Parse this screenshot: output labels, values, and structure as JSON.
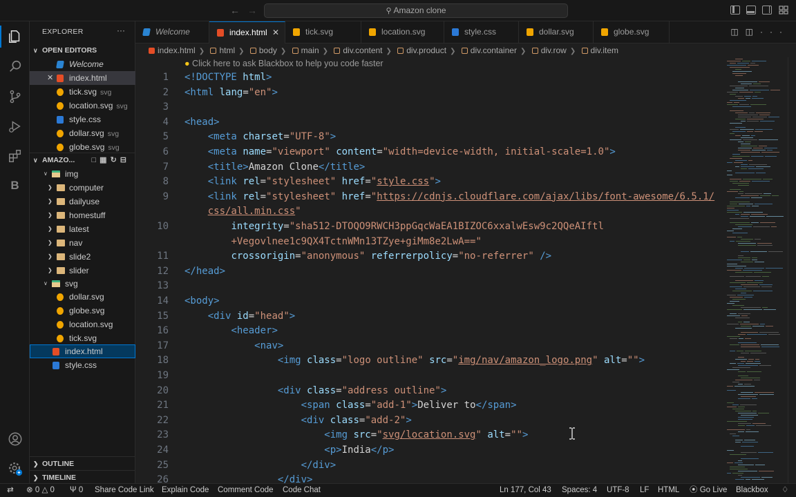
{
  "titlebar": {
    "search_text": "Amazon clone",
    "back_icon": "arrow-left",
    "forward_icon": "arrow-right"
  },
  "activitybar": {
    "items": [
      "explorer",
      "search",
      "source-control",
      "run-and-debug",
      "extensions",
      "blackbox"
    ],
    "blackbox_letter": "B"
  },
  "sidebar": {
    "title": "EXPLORER",
    "more": "···",
    "open_editors": {
      "title": "OPEN EDITORS",
      "items": [
        {
          "name": "Welcome",
          "desc": ""
        },
        {
          "name": "index.html",
          "desc": ""
        },
        {
          "name": "tick.svg",
          "desc": "svg"
        },
        {
          "name": "location.svg",
          "desc": "svg"
        },
        {
          "name": "style.css",
          "desc": ""
        },
        {
          "name": "dollar.svg",
          "desc": "svg"
        },
        {
          "name": "globe.svg",
          "desc": "svg"
        }
      ]
    },
    "workspace": {
      "title": "AMAZO...",
      "tree": [
        {
          "name": "img"
        },
        {
          "name": "computer"
        },
        {
          "name": "dailyuse"
        },
        {
          "name": "homestuff"
        },
        {
          "name": "latest"
        },
        {
          "name": "nav"
        },
        {
          "name": "slide2"
        },
        {
          "name": "slider"
        },
        {
          "name": "svg"
        },
        {
          "name": "dollar.svg"
        },
        {
          "name": "globe.svg"
        },
        {
          "name": "location.svg"
        },
        {
          "name": "tick.svg"
        },
        {
          "name": "index.html"
        },
        {
          "name": "style.css"
        }
      ]
    },
    "outline": "OUTLINE",
    "timeline": "TIMELINE"
  },
  "tabs": [
    {
      "label": "Welcome"
    },
    {
      "label": "index.html"
    },
    {
      "label": "tick.svg"
    },
    {
      "label": "location.svg"
    },
    {
      "label": "style.css"
    },
    {
      "label": "dollar.svg"
    },
    {
      "label": "globe.svg"
    }
  ],
  "breadcrumb": [
    "index.html",
    "html",
    "body",
    "main",
    "div.content",
    "div.product",
    "div.container",
    "div.row",
    "div.item"
  ],
  "editor": {
    "hint": "Click here to ask Blackbox to help you code faster",
    "lines": [
      {
        "n": "1",
        "html": "<span class='t'>&lt;!DOCTYPE</span> <span class='a'>html</span><span class='t'>&gt;</span>"
      },
      {
        "n": "2",
        "html": "<span class='t'>&lt;html</span> <span class='a'>lang</span><span class='x'>=</span><span class='s'>\"en\"</span><span class='t'>&gt;</span>"
      },
      {
        "n": "3",
        "html": ""
      },
      {
        "n": "4",
        "html": "<span class='t'>&lt;head&gt;</span>"
      },
      {
        "n": "5",
        "html": "    <span class='t'>&lt;meta</span> <span class='a'>charset</span><span class='x'>=</span><span class='s'>\"UTF-8\"</span><span class='t'>&gt;</span>"
      },
      {
        "n": "6",
        "html": "    <span class='t'>&lt;meta</span> <span class='a'>name</span><span class='x'>=</span><span class='s'>\"viewport\"</span> <span class='a'>content</span><span class='x'>=</span><span class='s'>\"width=device-width, initial-scale=1.0\"</span><span class='t'>&gt;</span>"
      },
      {
        "n": "7",
        "html": "    <span class='t'>&lt;title&gt;</span><span class='x'>Amazon Clone</span><span class='t'>&lt;/title&gt;</span>"
      },
      {
        "n": "8",
        "html": "    <span class='t'>&lt;link</span> <span class='a'>rel</span><span class='x'>=</span><span class='s'>\"stylesheet\"</span> <span class='a'>href</span><span class='x'>=</span><span class='s'>\"</span><span class='u'>style.css</span><span class='s'>\"</span><span class='t'>&gt;</span>"
      },
      {
        "n": "9",
        "html": "    <span class='t'>&lt;link</span> <span class='a'>rel</span><span class='x'>=</span><span class='s'>\"stylesheet\"</span> <span class='a'>href</span><span class='x'>=</span><span class='s'>\"</span><span class='u'>https://cdnjs.cloudflare.com/ajax/libs/font-awesome/6.5.1/</span>"
      },
      {
        "n": "",
        "html": "    <span class='u'>css/all.min.css</span><span class='s'>\"</span>"
      },
      {
        "n": "10",
        "html": "        <span class='a'>integrity</span><span class='x'>=</span><span class='s'>\"sha512-DTOQO9RWCH3ppGqcWaEA1BIZOC6xxalwEsw9c2QQeAIftl</span>"
      },
      {
        "n": "",
        "html": "        <span class='s'>+Vegovlnee1c9QX4TctnWMn13TZye+giMm8e2LwA==\"</span>"
      },
      {
        "n": "11",
        "html": "        <span class='a'>crossorigin</span><span class='x'>=</span><span class='s'>\"anonymous\"</span> <span class='a'>referrerpolicy</span><span class='x'>=</span><span class='s'>\"no-referrer\"</span> <span class='t'>/&gt;</span>"
      },
      {
        "n": "12",
        "html": "<span class='t'>&lt;/head&gt;</span>"
      },
      {
        "n": "13",
        "html": ""
      },
      {
        "n": "14",
        "html": "<span class='t'>&lt;body&gt;</span>"
      },
      {
        "n": "15",
        "html": "    <span class='t'>&lt;div</span> <span class='a'>id</span><span class='x'>=</span><span class='s'>\"head\"</span><span class='t'>&gt;</span>"
      },
      {
        "n": "16",
        "html": "        <span class='t'>&lt;header&gt;</span>"
      },
      {
        "n": "17",
        "html": "            <span class='t'>&lt;nav&gt;</span>"
      },
      {
        "n": "18",
        "html": "                <span class='t'>&lt;img</span> <span class='a'>class</span><span class='x'>=</span><span class='s'>\"logo outline\"</span> <span class='a'>src</span><span class='x'>=</span><span class='s'>\"</span><span class='u'>img/nav/amazon_logo.png</span><span class='s'>\"</span> <span class='a'>alt</span><span class='x'>=</span><span class='s'>\"\"</span><span class='t'>&gt;</span>"
      },
      {
        "n": "19",
        "html": ""
      },
      {
        "n": "20",
        "html": "                <span class='t'>&lt;div</span> <span class='a'>class</span><span class='x'>=</span><span class='s'>\"address outline\"</span><span class='t'>&gt;</span>"
      },
      {
        "n": "21",
        "html": "                    <span class='t'>&lt;span</span> <span class='a'>class</span><span class='x'>=</span><span class='s'>\"add-1\"</span><span class='t'>&gt;</span><span class='x'>Deliver to</span><span class='t'>&lt;/span&gt;</span>"
      },
      {
        "n": "22",
        "html": "                    <span class='t'>&lt;div</span> <span class='a'>class</span><span class='x'>=</span><span class='s'>\"add-2\"</span><span class='t'>&gt;</span>"
      },
      {
        "n": "23",
        "html": "                        <span class='t'>&lt;img</span> <span class='a'>src</span><span class='x'>=</span><span class='s'>\"</span><span class='u'>svg/location.svg</span><span class='s'>\"</span> <span class='a'>alt</span><span class='x'>=</span><span class='s'>\"\"</span><span class='t'>&gt;</span>"
      },
      {
        "n": "24",
        "html": "                        <span class='t'>&lt;p&gt;</span><span class='x'>India</span><span class='t'>&lt;/p&gt;</span>"
      },
      {
        "n": "25",
        "html": "                    <span class='t'>&lt;/div&gt;</span>"
      },
      {
        "n": "26",
        "html": "                <span class='t'>&lt;/div&gt;</span>"
      }
    ]
  },
  "statusbar": {
    "errors": "0",
    "warnings": "0",
    "ports": "0",
    "share": "Share Code Link",
    "explain": "Explain Code",
    "comment": "Comment Code",
    "chat": "Code Chat",
    "position": "Ln 177, Col 43",
    "spaces": "Spaces: 4",
    "encoding": "UTF-8",
    "eol": "LF",
    "language": "HTML",
    "golive": "Go Live",
    "blackbox": "Blackbox"
  },
  "colors": {
    "accent": "#0078d4",
    "background": "#1f1f1f",
    "sidebar": "#181818"
  }
}
